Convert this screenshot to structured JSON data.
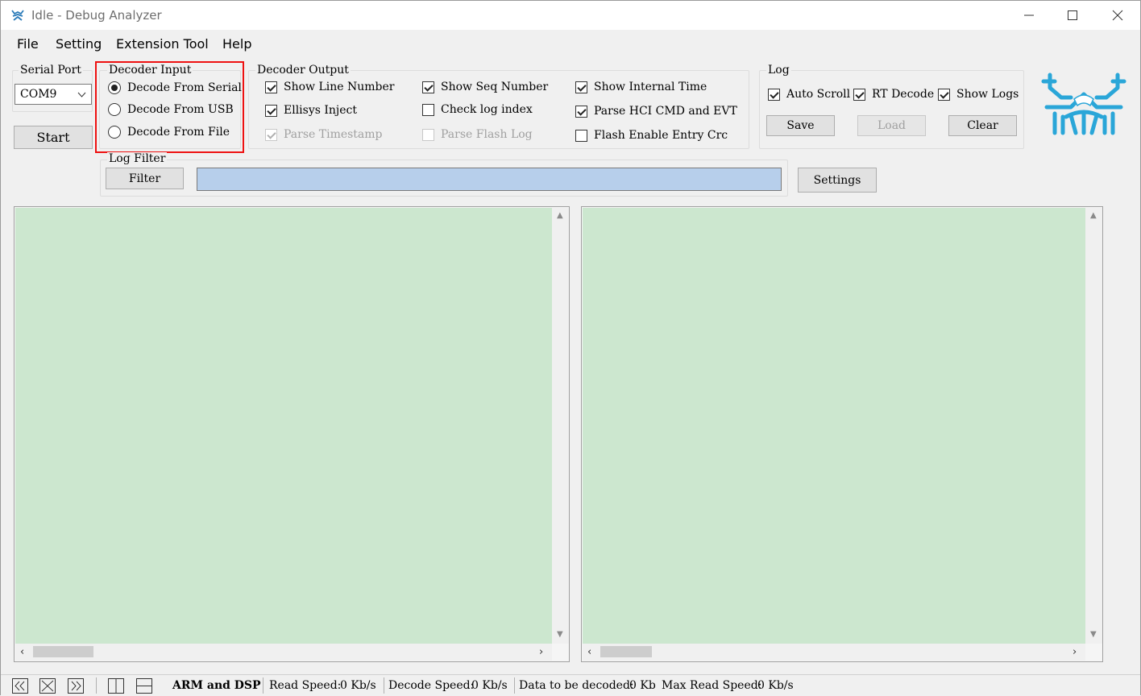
{
  "window": {
    "title": "Idle - Debug Analyzer",
    "minimize": "minimize",
    "maximize": "maximize",
    "close": "close"
  },
  "menu": [
    "File",
    "Setting",
    "Extension Tool",
    "Help"
  ],
  "serial_port": {
    "group_title": "Serial Port",
    "selected": "COM9",
    "start_label": "Start"
  },
  "decoder_input": {
    "group_title": "Decoder Input",
    "options": [
      {
        "label": "Decode From Serial",
        "checked": true
      },
      {
        "label": "Decode From USB",
        "checked": false
      },
      {
        "label": "Decode From File",
        "checked": false
      }
    ]
  },
  "decoder_output": {
    "group_title": "Decoder Output",
    "options": [
      {
        "label": "Show Line Number",
        "checked": true,
        "enabled": true
      },
      {
        "label": "Ellisys Inject",
        "checked": true,
        "enabled": true
      },
      {
        "label": "Parse Timestamp",
        "checked": true,
        "enabled": false
      },
      {
        "label": "Show Seq Number",
        "checked": true,
        "enabled": true
      },
      {
        "label": "Check log index",
        "checked": false,
        "enabled": true
      },
      {
        "label": "Parse Flash Log",
        "checked": false,
        "enabled": false
      },
      {
        "label": "Show Internal Time",
        "checked": true,
        "enabled": true
      },
      {
        "label": "Parse HCI CMD and EVT",
        "checked": true,
        "enabled": true
      },
      {
        "label": "Flash Enable Entry Crc",
        "checked": false,
        "enabled": true
      }
    ]
  },
  "log": {
    "group_title": "Log",
    "options": [
      {
        "label": "Auto Scroll",
        "checked": true
      },
      {
        "label": "RT Decode",
        "checked": true
      },
      {
        "label": "Show Logs",
        "checked": true
      }
    ],
    "save_label": "Save",
    "load_label": "Load",
    "clear_label": "Clear"
  },
  "log_filter": {
    "group_title": "Log Filter",
    "filter_label": "Filter",
    "value": "",
    "settings_label": "Settings"
  },
  "status": {
    "mode": "ARM and DSP",
    "read_speed_label": "Read Speed:",
    "read_speed": "0 Kb/s",
    "decode_speed_label": "Decode Speed:",
    "decode_speed": "0 Kb/s",
    "to_decode_label": "Data to be decoded:",
    "to_decode": "0 Kb",
    "max_read_label": "Max Read Speed:",
    "max_read": "0 Kb/s"
  },
  "colors": {
    "pane_bg": "#cce7cf",
    "filter_bg": "#b7cfeb",
    "highlight": "#e11111",
    "logo": "#2aa6d8"
  }
}
